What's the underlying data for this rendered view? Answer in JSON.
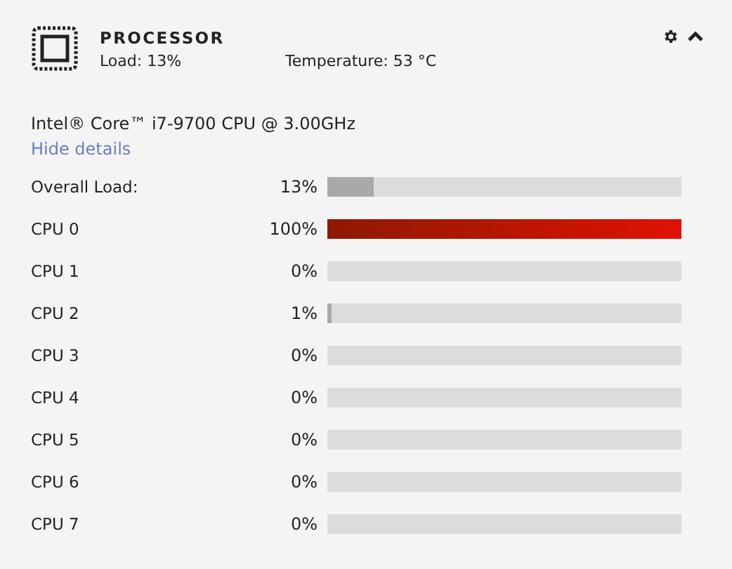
{
  "panel": {
    "title": "PROCESSOR",
    "load": "Load: 13%",
    "temperature": "Temperature: 53 °C",
    "expanded": true
  },
  "cpu_name": "Intel® Core™ i7-9700 CPU @ 3.00GHz",
  "details_link": "Hide details",
  "rows": [
    {
      "label": "Overall Load:",
      "reading": "13%",
      "level": 0.13
    },
    {
      "label": "CPU 0",
      "reading": "100%",
      "level": 1.0
    },
    {
      "label": "CPU 1",
      "reading": "0%"
    },
    {
      "label": "CPU 2",
      "reading": "1%",
      "level": 0.01
    },
    {
      "label": "CPU 3",
      "reading": "0%"
    },
    {
      "label": "CPU 4",
      "reading": "0%"
    },
    {
      "label": "CPU 5",
      "reading": "0%"
    },
    {
      "label": "CPU 6",
      "reading": "0%"
    },
    {
      "label": "CPU 7",
      "reading": "0%"
    }
  ]
}
